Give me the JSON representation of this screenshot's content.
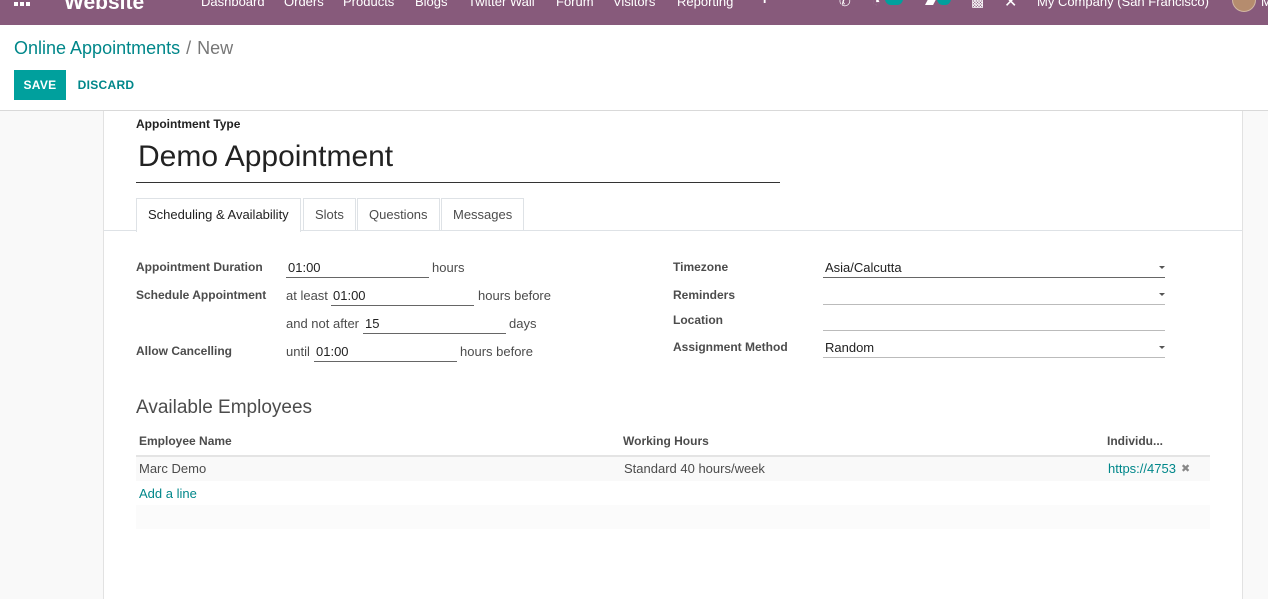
{
  "navbar": {
    "brand": "Website",
    "menu": [
      "Dashboard",
      "Orders",
      "Products",
      "Blogs",
      "Twitter Wall",
      "Forum",
      "Visitors",
      "Reporting"
    ],
    "company": "My Company (San Francisco)",
    "user_initial": "M"
  },
  "breadcrumb": {
    "parent": "Online Appointments",
    "separator": "/",
    "current": "New"
  },
  "toolbar": {
    "save_label": "SAVE",
    "discard_label": "DISCARD"
  },
  "form": {
    "type_label": "Appointment Type",
    "name": "Demo Appointment",
    "tabs": [
      "Scheduling & Availability",
      "Slots",
      "Questions",
      "Messages"
    ],
    "duration": {
      "label": "Appointment Duration",
      "value": "01:00",
      "suffix": "hours"
    },
    "schedule": {
      "label": "Schedule Appointment",
      "at_least_prefix": "at least",
      "at_least_value": "01:00",
      "at_least_suffix": "hours before",
      "not_after_prefix": "and not after",
      "not_after_value": "15",
      "not_after_suffix": "days"
    },
    "cancelling": {
      "label": "Allow Cancelling",
      "prefix": "until",
      "value": "01:00",
      "suffix": "hours before"
    },
    "timezone": {
      "label": "Timezone",
      "value": "Asia/Calcutta"
    },
    "reminders": {
      "label": "Reminders",
      "value": ""
    },
    "location": {
      "label": "Location",
      "value": ""
    },
    "assignment": {
      "label": "Assignment Method",
      "value": "Random"
    }
  },
  "employees": {
    "title": "Available Employees",
    "columns": [
      "Employee Name",
      "Working Hours",
      "Individu..."
    ],
    "rows": [
      {
        "name": "Marc Demo",
        "hours": "Standard 40 hours/week",
        "url": "https://4753"
      }
    ],
    "add_line": "Add a line"
  }
}
